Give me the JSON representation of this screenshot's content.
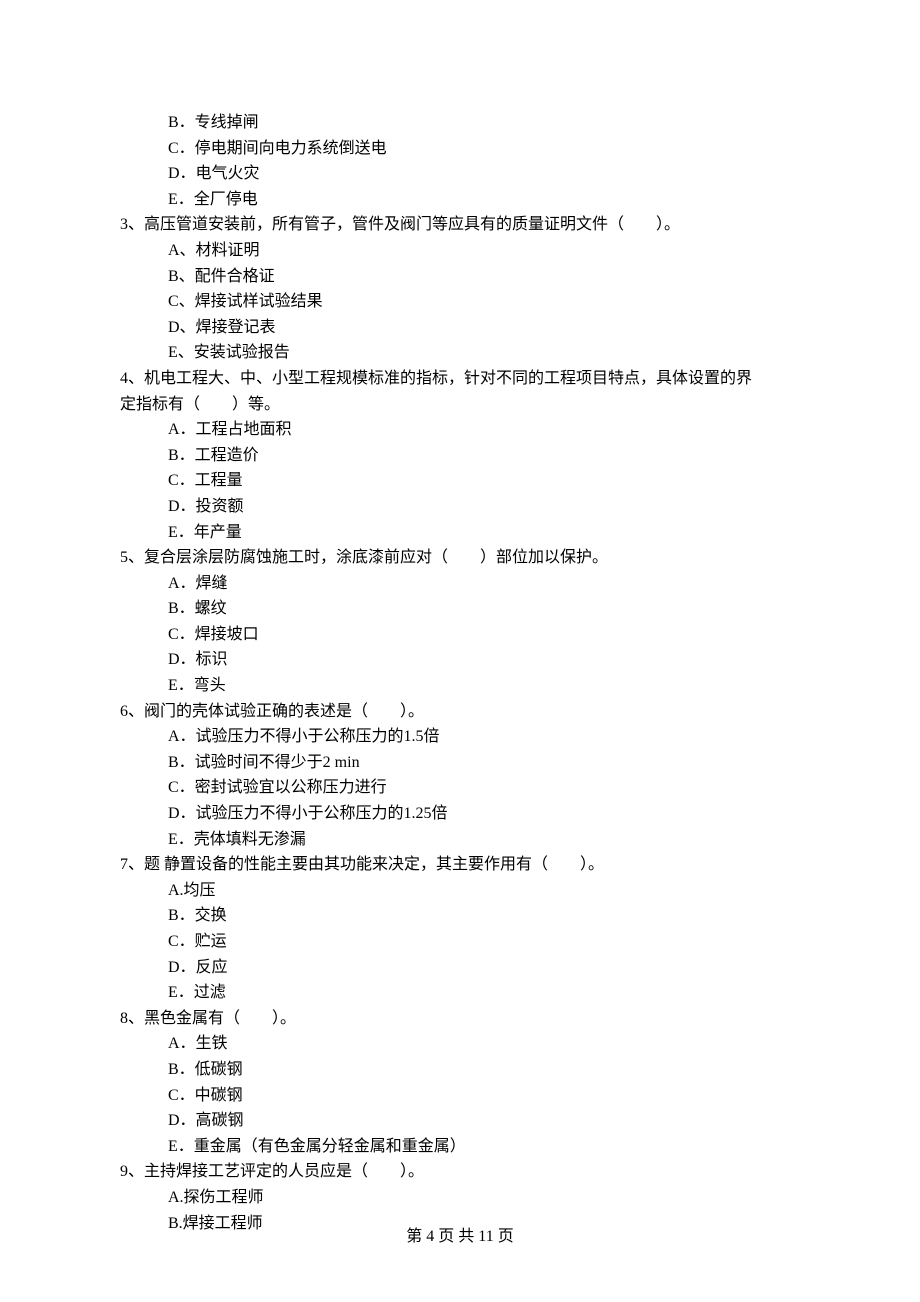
{
  "lines": [
    {
      "cls": "option",
      "text": "B．专线掉闸"
    },
    {
      "cls": "option",
      "text": "C．停电期间向电力系统倒送电"
    },
    {
      "cls": "option",
      "text": "D．电气火灾"
    },
    {
      "cls": "option",
      "text": "E．全厂停电"
    },
    {
      "cls": "question",
      "text": "3、高压管道安装前，所有管子，管件及阀门等应具有的质量证明文件（　　）。"
    },
    {
      "cls": "option",
      "text": "A、材料证明"
    },
    {
      "cls": "option",
      "text": "B、配件合格证"
    },
    {
      "cls": "option",
      "text": "C、焊接试样试验结果"
    },
    {
      "cls": "option",
      "text": "D、焊接登记表"
    },
    {
      "cls": "option",
      "text": "E、安装试验报告"
    },
    {
      "cls": "question",
      "text": "4、机电工程大、中、小型工程规模标准的指标，针对不同的工程项目特点，具体设置的界"
    },
    {
      "cls": "question-cont",
      "text": "定指标有（　　）等。"
    },
    {
      "cls": "option",
      "text": "A．工程占地面积"
    },
    {
      "cls": "option",
      "text": "B．工程造价"
    },
    {
      "cls": "option",
      "text": "C．工程量"
    },
    {
      "cls": "option",
      "text": "D．投资额"
    },
    {
      "cls": "option",
      "text": "E．年产量"
    },
    {
      "cls": "question",
      "text": "5、复合层涂层防腐蚀施工时，涂底漆前应对（　　）部位加以保护。"
    },
    {
      "cls": "option",
      "text": "A．焊缝"
    },
    {
      "cls": "option",
      "text": "B．螺纹"
    },
    {
      "cls": "option",
      "text": "C．焊接坡口"
    },
    {
      "cls": "option",
      "text": "D．标识"
    },
    {
      "cls": "option",
      "text": "E．弯头"
    },
    {
      "cls": "question",
      "text": "6、阀门的壳体试验正确的表述是（　　）。"
    },
    {
      "cls": "option",
      "text": "A．试验压力不得小于公称压力的1.5倍"
    },
    {
      "cls": "option",
      "text": "B．试验时间不得少于2 min"
    },
    {
      "cls": "option",
      "text": "C．密封试验宜以公称压力进行"
    },
    {
      "cls": "option",
      "text": "D．试验压力不得小于公称压力的1.25倍"
    },
    {
      "cls": "option",
      "text": "E．壳体填料无渗漏"
    },
    {
      "cls": "question",
      "text": "7、题 静置设备的性能主要由其功能来决定，其主要作用有（　　）。"
    },
    {
      "cls": "option",
      "text": "A.均压"
    },
    {
      "cls": "option",
      "text": "B．交换"
    },
    {
      "cls": "option",
      "text": "C．贮运"
    },
    {
      "cls": "option",
      "text": "D．反应"
    },
    {
      "cls": "option",
      "text": "E．过滤"
    },
    {
      "cls": "question",
      "text": "8、黑色金属有（　　）。"
    },
    {
      "cls": "option",
      "text": "A．生铁"
    },
    {
      "cls": "option",
      "text": "B．低碳钢"
    },
    {
      "cls": "option",
      "text": "C．中碳钢"
    },
    {
      "cls": "option",
      "text": "D．高碳钢"
    },
    {
      "cls": "option",
      "text": "E．重金属（有色金属分轻金属和重金属）"
    },
    {
      "cls": "question",
      "text": "9、主持焊接工艺评定的人员应是（　　）。"
    },
    {
      "cls": "option",
      "text": "A.探伤工程师"
    },
    {
      "cls": "option",
      "text": "B.焊接工程师"
    }
  ],
  "footer": "第 4 页 共 11 页"
}
